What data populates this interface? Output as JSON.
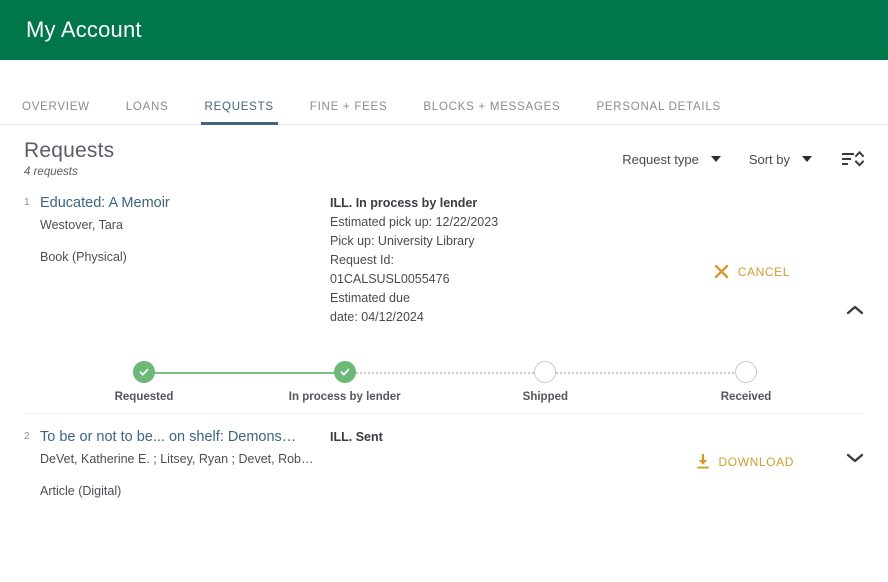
{
  "header": {
    "title": "My Account",
    "brand_color": "#00774a"
  },
  "tabs": {
    "active_index": 2,
    "accent_color": "#45637f",
    "items": [
      {
        "label": "OVERVIEW",
        "name": "tab-overview"
      },
      {
        "label": "LOANS",
        "name": "tab-loans"
      },
      {
        "label": "REQUESTS",
        "name": "tab-requests"
      },
      {
        "label": "FINE + FEES",
        "name": "tab-fine-fees"
      },
      {
        "label": "BLOCKS + MESSAGES",
        "name": "tab-blocks-messages"
      },
      {
        "label": "PERSONAL DETAILS",
        "name": "tab-personal-details"
      }
    ]
  },
  "list_header": {
    "title": "Requests",
    "count_text": "4 requests",
    "request_type_label": "Request type",
    "sort_by_label": "Sort by",
    "sort_icon": "sort-lines-icon"
  },
  "requests": [
    {
      "index": "1",
      "title": "Educated: A Memoir",
      "author": "Westover, Tara",
      "format": "Book (Physical)",
      "status": "ILL. In process by lender",
      "details": [
        "Estimated pick up: 12/22/2023",
        "Pick up: University Library",
        "Request Id:",
        "01CALSUSL0055476",
        "Estimated due",
        "date: 04/12/2024"
      ],
      "action_label": "CANCEL",
      "action_icon": "close-x-icon",
      "action_color": "#d99a2b",
      "expanded": true,
      "expander_icon": "chevron-up-icon",
      "tracker": {
        "steps": [
          {
            "label": "Requested",
            "state": "done"
          },
          {
            "label": "In process by lender",
            "state": "done"
          },
          {
            "label": "Shipped",
            "state": "pending"
          },
          {
            "label": "Received",
            "state": "pending"
          }
        ],
        "done_color": "#6cb877",
        "pending_color": "#c9c9cf"
      }
    },
    {
      "index": "2",
      "title": "To be or not to be... on shelf: Demons…",
      "author": "DeVet, Katherine E. ; Litsey, Ryan ; Devet, Rob…",
      "format": "Article (Digital)",
      "status": "ILL. Sent",
      "details": [],
      "action_label": "DOWNLOAD",
      "action_icon": "download-icon",
      "action_color": "#d99a2b",
      "expanded": false,
      "expander_icon": "chevron-down-icon",
      "tracker": null
    }
  ]
}
